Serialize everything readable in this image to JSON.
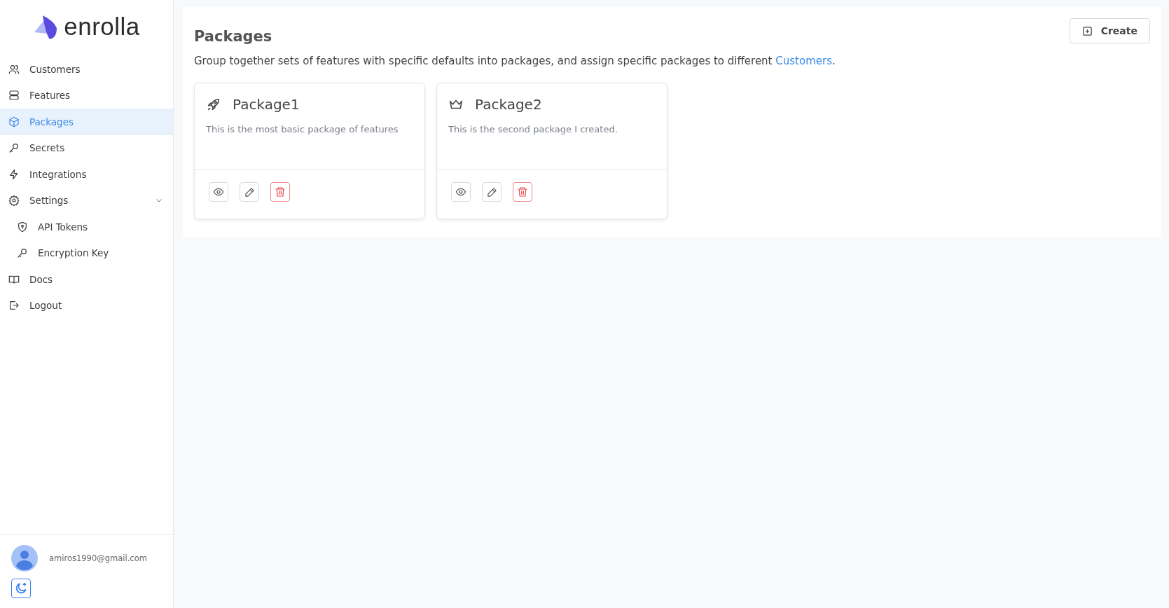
{
  "sidebar": {
    "logo": "enrolla",
    "items": [
      {
        "label": "Customers",
        "selected": false
      },
      {
        "label": "Features",
        "selected": false
      },
      {
        "label": "Packages",
        "selected": true
      },
      {
        "label": "Secrets",
        "selected": false
      },
      {
        "label": "Integrations",
        "selected": false
      },
      {
        "label": "Settings",
        "selected": false,
        "expanded": true,
        "children": [
          {
            "label": "API Tokens",
            "selected": false
          },
          {
            "label": "Encryption Key",
            "selected": false
          }
        ]
      },
      {
        "label": "Docs",
        "selected": false
      },
      {
        "label": "Logout",
        "selected": false
      }
    ],
    "user": {
      "email": "amiros1990@gmail.com"
    }
  },
  "page": {
    "title": "Packages",
    "create_button": "Create",
    "description_before": "Group together sets of features with specific defaults into packages, and assign specific packages to different ",
    "description_link": "Customers",
    "description_after": ".",
    "packages": [
      {
        "name": "Package1",
        "description": "This is the most basic package of features"
      },
      {
        "name": "Package2",
        "description": "This is the second package I created."
      }
    ]
  }
}
